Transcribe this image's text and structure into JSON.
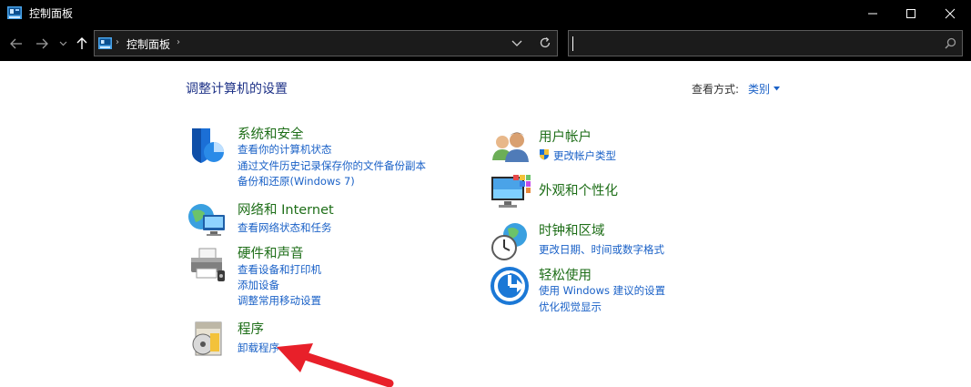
{
  "window": {
    "title": "控制面板"
  },
  "address": {
    "crumb": "控制面板"
  },
  "search": {
    "placeholder": ""
  },
  "content": {
    "heading": "调整计算机的设置",
    "view_label": "查看方式:",
    "view_value": "类别"
  },
  "categories": {
    "system": {
      "title": "系统和安全",
      "icon": "shield-icon",
      "links": [
        "查看你的计算机状态",
        "通过文件历史记录保存你的文件备份副本",
        "备份和还原(Windows 7)"
      ]
    },
    "network": {
      "title": "网络和 Internet",
      "icon": "globe-network-icon",
      "links": [
        "查看网络状态和任务"
      ]
    },
    "hardware": {
      "title": "硬件和声音",
      "icon": "printer-icon",
      "links": [
        "查看设备和打印机",
        "添加设备",
        "调整常用移动设置"
      ]
    },
    "programs": {
      "title": "程序",
      "icon": "programs-disc-icon",
      "links": [
        "卸载程序"
      ]
    },
    "users": {
      "title": "用户帐户",
      "icon": "users-icon",
      "links": [
        "更改帐户类型"
      ]
    },
    "appearance": {
      "title": "外观和个性化",
      "icon": "monitor-palette-icon",
      "links": []
    },
    "clock": {
      "title": "时钟和区域",
      "icon": "clock-globe-icon",
      "links": [
        "更改日期、时间或数字格式"
      ]
    },
    "ease": {
      "title": "轻松使用",
      "icon": "ease-of-access-icon",
      "links": [
        "使用 Windows 建议的设置",
        "优化视觉显示"
      ]
    }
  },
  "colors": {
    "link": "#1a61c7",
    "category_title": "#1e6e18",
    "heading": "#1e3287",
    "titlebar": "#000000",
    "annotation_arrow": "#e8202a"
  }
}
